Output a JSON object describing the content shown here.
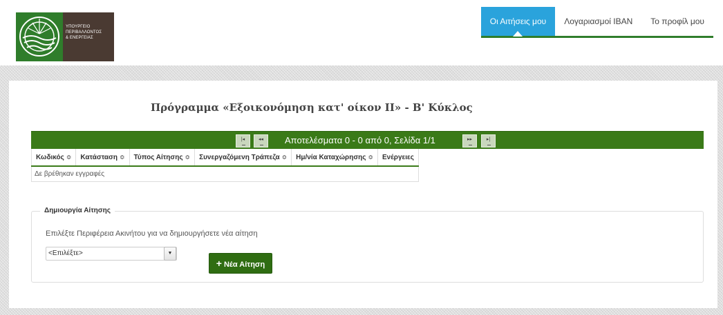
{
  "logo": {
    "line1": "ΥΠΟΥΡΓΕΙΟ",
    "line2": "ΠΕΡΙΒΑΛΛΟΝΤΟΣ",
    "line3": "& ΕΝΕΡΓΕΙΑΣ"
  },
  "nav": {
    "items": [
      {
        "label": "Οι Αιτήσεις μου",
        "active": true
      },
      {
        "label": "Λογαριασμοί IBAN",
        "active": false
      },
      {
        "label": "Το προφίλ μου",
        "active": false
      }
    ]
  },
  "page": {
    "title": "Πρόγραμμα «Εξοικονόμηση κατ' οίκον ΙΙ» - Β' Κύκλος"
  },
  "pager": {
    "first_icon": "first-page-icon",
    "prev_icon": "prev-page-icon",
    "next_icon": "next-page-icon",
    "last_icon": "last-page-icon",
    "results_text": "Αποτελέσματα 0 - 0 από 0, Σελίδα 1/1"
  },
  "table": {
    "columns": [
      "Κωδικός",
      "Κατάσταση",
      "Τύπος Αίτησης",
      "Συνεργαζόμενη Τράπεζα",
      "Ημ/νία Καταχώρησης",
      "Ενέργειες"
    ],
    "sort_glyph": "≎",
    "empty_text": "Δε βρέθηκαν εγγραφές"
  },
  "create": {
    "legend": "Δημιουργία Αίτησης",
    "help_text": "Επιλέξτε Περιφέρεια Ακινήτου για να δημιουργήσετε νέα αίτηση",
    "select_value": "<Επιλέξτε>",
    "button_label": "Νέα Αίτηση",
    "button_icon": "+"
  },
  "colors": {
    "brand_green": "#3a7a18",
    "nav_active": "#2aa3dc",
    "logo_brown": "#4a3a32"
  }
}
